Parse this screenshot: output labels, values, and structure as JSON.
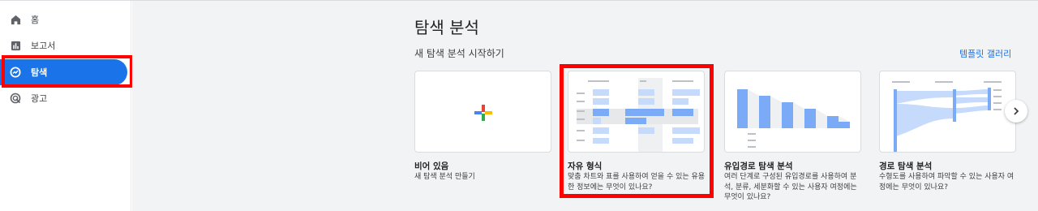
{
  "sidebar": {
    "items": [
      {
        "label": "홈",
        "icon": "home-icon"
      },
      {
        "label": "보고서",
        "icon": "reports-icon"
      },
      {
        "label": "탐색",
        "icon": "explore-icon",
        "active": true
      },
      {
        "label": "광고",
        "icon": "advertising-icon"
      }
    ]
  },
  "main": {
    "title": "탐색 분석",
    "section_title": "새 탐색 분석 시작하기",
    "gallery_link": "템플릿 갤러리",
    "cards": [
      {
        "title": "비어 있음",
        "desc": "새 탐색 분석 만들기"
      },
      {
        "title": "자유 형식",
        "desc": "맞춤 차트와 표를 사용하여 얻을 수 있는 유용한 정보에는 무엇이 있나요?"
      },
      {
        "title": "유입경로 탐색 분석",
        "desc": "여러 단계로 구성된 유입경로를 사용하여 분석, 분류, 세분화할 수 있는 사용자 여정에는 무엇이 있나요?"
      },
      {
        "title": "경로 탐색 분석",
        "desc": "수형도를 사용하여 파악할 수 있는 사용자 여정에는 무엇이 있나요?"
      }
    ]
  },
  "colors": {
    "accent": "#1a73e8",
    "highlight": "#ff0000",
    "thumb_blue": "#7baaf7",
    "thumb_light_blue": "#c6dafc"
  }
}
